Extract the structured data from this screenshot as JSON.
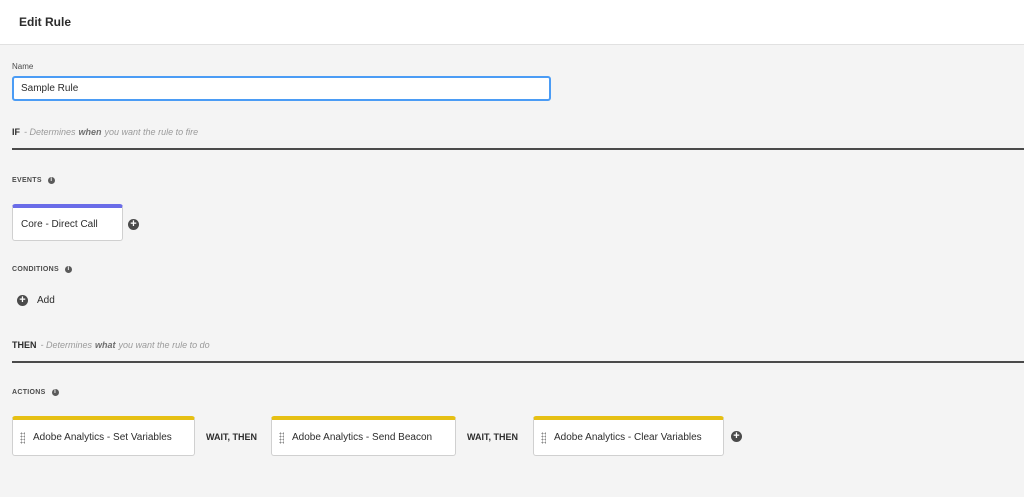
{
  "header": {
    "title": "Edit Rule"
  },
  "name_field": {
    "label": "Name",
    "value": "Sample Rule"
  },
  "if_section": {
    "keyword": "IF",
    "prefix": "- Determines",
    "emphasis": "when",
    "suffix": "you want the rule to fire"
  },
  "events": {
    "label": "EVENTS",
    "items": [
      {
        "label": "Core - Direct Call"
      }
    ]
  },
  "conditions": {
    "label": "CONDITIONS",
    "add_label": "Add"
  },
  "then_section": {
    "keyword": "THEN",
    "prefix": "- Determines",
    "emphasis": "what",
    "suffix": "you want the rule to do"
  },
  "actions": {
    "label": "ACTIONS",
    "items": [
      {
        "label": "Adobe Analytics - Set Variables"
      },
      {
        "label": "Adobe Analytics - Send Beacon"
      },
      {
        "label": "Adobe Analytics - Clear Variables"
      }
    ],
    "separators": [
      "WAIT, THEN",
      "WAIT, THEN"
    ]
  },
  "icons": {
    "info": "info-icon",
    "add": "plus-circle-icon",
    "drag": "drag-handle-icon"
  },
  "colors": {
    "event_accent": "#6a6ce8",
    "action_accent": "#e6c014",
    "input_focus": "#4b9cf5"
  }
}
